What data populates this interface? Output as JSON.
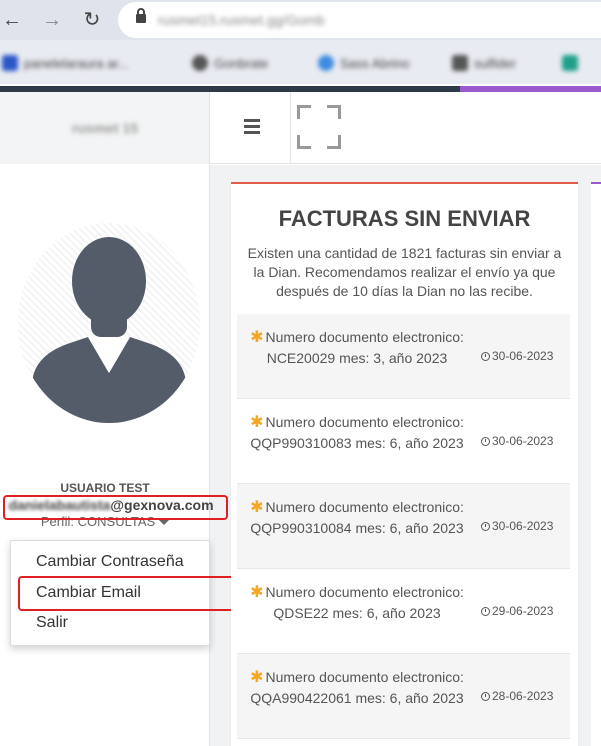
{
  "browser": {
    "url": "rusmet15.rusmet.gg/Gomb",
    "bookmarks": [
      "panelelaraura ar...",
      "Gonbrate",
      "Sass Abrino",
      "sulfider",
      ""
    ]
  },
  "header": {
    "brand": "rusmet 15",
    "brand_color": "#2e3a48",
    "accent_color": "#9b59d0"
  },
  "user": {
    "name": "USUARIO TEST",
    "email_local": "danielabautista",
    "email_domain": "@gexnova.com",
    "profile": "Perfil: CONSULTAS"
  },
  "dropdown": {
    "items": [
      "Cambiar Contraseña",
      "Cambiar Email",
      "Salir"
    ]
  },
  "panel": {
    "title": "FACTURAS SIN ENVIAR",
    "description": "Existen una cantidad de 1821 facturas sin enviar a la Dian. Recomendamos realizar el envío ya que después de 10 días la Dian no las recibe.",
    "items": [
      {
        "text": "Numero documento electronico: NCE20029 mes: 3, año 2023",
        "date": "30-06-2023"
      },
      {
        "text": "Numero documento electronico: QQP990310083 mes: 6, año 2023",
        "date": "30-06-2023"
      },
      {
        "text": "Numero documento electronico: QQP990310084 mes: 6, año 2023",
        "date": "30-06-2023"
      },
      {
        "text": "Numero documento electronico: QDSE22 mes: 6, año 2023",
        "date": "29-06-2023"
      },
      {
        "text": "Numero documento electronico: QQA990422061 mes: 6, año 2023",
        "date": "28-06-2023"
      }
    ]
  },
  "icons": {
    "star": "✱",
    "menu": "hamburger-icon",
    "fullscreen": "fullscreen-icon"
  }
}
